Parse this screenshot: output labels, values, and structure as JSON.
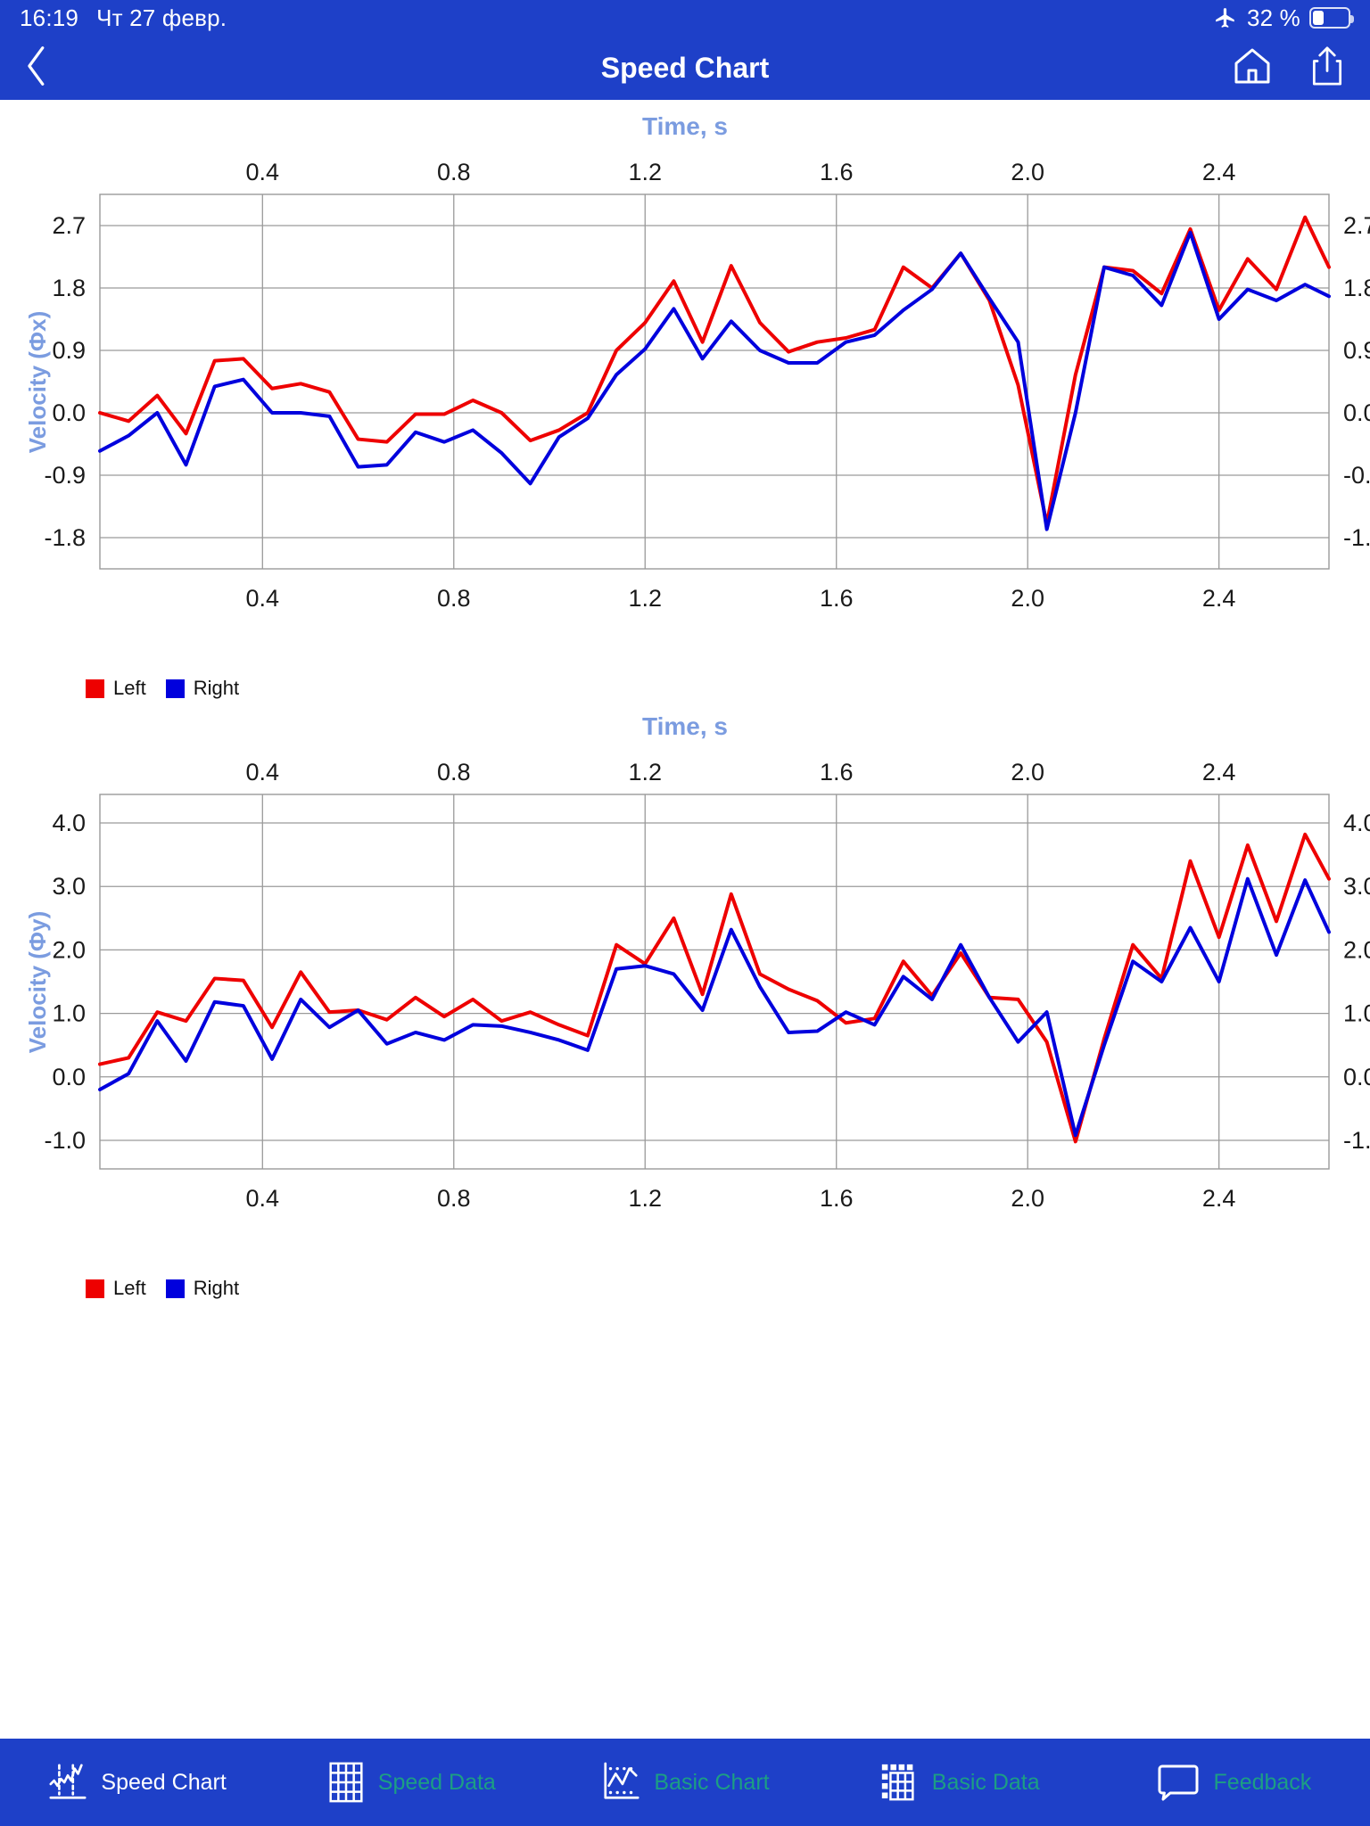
{
  "status_bar": {
    "time": "16:19",
    "date": "Чт 27 февр.",
    "airplane_icon": "airplane-mode-icon",
    "battery_percent": "32 %",
    "battery_level": 32
  },
  "nav_bar": {
    "back_icon": "chevron-left-icon",
    "title": "Speed Chart",
    "home_icon": "home-icon",
    "share_icon": "share-icon"
  },
  "charts": [
    {
      "id": "speed-chart-x",
      "title": "Time, s",
      "ylabel": "Velocity (Фx)",
      "legend": [
        {
          "label": "Left",
          "color": "#ee0000"
        },
        {
          "label": "Right",
          "color": "#0000dd"
        }
      ]
    },
    {
      "id": "speed-chart-y",
      "title": "Time, s",
      "ylabel": "Velocity (Фy)",
      "legend": [
        {
          "label": "Left",
          "color": "#ee0000"
        },
        {
          "label": "Right",
          "color": "#0000dd"
        }
      ]
    }
  ],
  "tab_bar": {
    "items": [
      {
        "label": "Speed Chart",
        "icon": "line-chart-icon",
        "active": true
      },
      {
        "label": "Speed Data",
        "icon": "grid-table-icon",
        "active": false
      },
      {
        "label": "Basic Chart",
        "icon": "scatter-chart-icon",
        "active": false
      },
      {
        "label": "Basic Data",
        "icon": "grid-table-partial-icon",
        "active": false
      },
      {
        "label": "Feedback",
        "icon": "speech-bubble-icon",
        "active": false
      }
    ],
    "active_color": "#ffffff",
    "inactive_color": "#1c9e84"
  },
  "chart_data": [
    {
      "type": "line",
      "id": "speed-chart-x",
      "title": "Time, s",
      "xlabel": "Time, s",
      "ylabel": "Velocity (Фx)",
      "xticks": [
        0.4,
        0.8,
        1.2,
        1.6,
        2.0,
        2.4
      ],
      "yticks": [
        -1.8,
        -0.9,
        0.0,
        0.9,
        1.8,
        2.7
      ],
      "xlim": [
        0.06,
        2.63
      ],
      "ylim": [
        -2.25,
        3.15
      ],
      "grid": true,
      "xaxis_position": "both",
      "yaxis_position": "both",
      "legend_position": "bottom-left",
      "x": [
        0.06,
        0.12,
        0.18,
        0.24,
        0.3,
        0.36,
        0.42,
        0.48,
        0.54,
        0.6,
        0.66,
        0.72,
        0.78,
        0.84,
        0.9,
        0.96,
        1.02,
        1.08,
        1.14,
        1.2,
        1.26,
        1.32,
        1.38,
        1.44,
        1.5,
        1.56,
        1.62,
        1.68,
        1.74,
        1.8,
        1.86,
        1.92,
        1.98,
        2.04,
        2.1,
        2.16,
        2.22,
        2.28,
        2.34,
        2.4,
        2.46,
        2.52,
        2.58,
        2.63
      ],
      "series": [
        {
          "name": "Left",
          "color": "#ee0000",
          "values": [
            0.0,
            -0.12,
            0.25,
            -0.3,
            0.75,
            0.78,
            0.35,
            0.42,
            0.3,
            -0.38,
            -0.42,
            -0.02,
            -0.02,
            0.18,
            0.0,
            -0.4,
            -0.25,
            0.0,
            0.9,
            1.3,
            1.9,
            1.02,
            2.12,
            1.3,
            0.88,
            1.02,
            1.08,
            1.2,
            2.1,
            1.8,
            2.3,
            1.62,
            0.4,
            -1.6,
            0.55,
            2.1,
            2.05,
            1.72,
            2.65,
            1.48,
            2.22,
            1.78,
            2.82,
            2.1
          ]
        },
        {
          "name": "Right",
          "color": "#0000dd",
          "values": [
            -0.55,
            -0.33,
            0.0,
            -0.75,
            0.38,
            0.48,
            0.0,
            0.0,
            -0.05,
            -0.78,
            -0.75,
            -0.28,
            -0.42,
            -0.25,
            -0.58,
            -1.02,
            -0.35,
            -0.08,
            0.55,
            0.92,
            1.5,
            0.78,
            1.32,
            0.9,
            0.72,
            0.72,
            1.02,
            1.12,
            1.48,
            1.78,
            2.3,
            1.65,
            1.02,
            -1.68,
            0.0,
            2.1,
            1.98,
            1.55,
            2.6,
            1.35,
            1.78,
            1.62,
            1.85,
            1.68
          ]
        }
      ]
    },
    {
      "type": "line",
      "id": "speed-chart-y",
      "title": "Time, s",
      "xlabel": "Time, s",
      "ylabel": "Velocity (Фy)",
      "xticks": [
        0.4,
        0.8,
        1.2,
        1.6,
        2.0,
        2.4
      ],
      "yticks": [
        -1.0,
        0.0,
        1.0,
        2.0,
        3.0,
        4.0
      ],
      "xlim": [
        0.06,
        2.63
      ],
      "ylim": [
        -1.45,
        4.45
      ],
      "grid": true,
      "xaxis_position": "both",
      "yaxis_position": "both",
      "legend_position": "bottom-left",
      "x": [
        0.06,
        0.12,
        0.18,
        0.24,
        0.3,
        0.36,
        0.42,
        0.48,
        0.54,
        0.6,
        0.66,
        0.72,
        0.78,
        0.84,
        0.9,
        0.96,
        1.02,
        1.08,
        1.14,
        1.2,
        1.26,
        1.32,
        1.38,
        1.44,
        1.5,
        1.56,
        1.62,
        1.68,
        1.74,
        1.8,
        1.86,
        1.92,
        1.98,
        2.04,
        2.1,
        2.16,
        2.22,
        2.28,
        2.34,
        2.4,
        2.46,
        2.52,
        2.58,
        2.63
      ],
      "series": [
        {
          "name": "Left",
          "color": "#ee0000",
          "values": [
            0.2,
            0.3,
            1.02,
            0.88,
            1.55,
            1.52,
            0.78,
            1.65,
            1.02,
            1.05,
            0.9,
            1.25,
            0.95,
            1.22,
            0.88,
            1.02,
            0.82,
            0.65,
            2.08,
            1.78,
            2.5,
            1.3,
            2.88,
            1.62,
            1.38,
            1.2,
            0.85,
            0.92,
            1.82,
            1.28,
            1.95,
            1.25,
            1.22,
            0.55,
            -1.02,
            0.6,
            2.08,
            1.55,
            3.4,
            2.2,
            3.65,
            2.45,
            3.82,
            3.12
          ]
        },
        {
          "name": "Right",
          "color": "#0000dd",
          "values": [
            -0.2,
            0.05,
            0.88,
            0.25,
            1.18,
            1.12,
            0.28,
            1.22,
            0.78,
            1.05,
            0.52,
            0.7,
            0.58,
            0.82,
            0.8,
            0.7,
            0.58,
            0.42,
            1.7,
            1.75,
            1.62,
            1.05,
            2.32,
            1.42,
            0.7,
            0.72,
            1.02,
            0.82,
            1.58,
            1.22,
            2.08,
            1.25,
            0.55,
            1.02,
            -0.92,
            0.5,
            1.82,
            1.5,
            2.35,
            1.5,
            3.12,
            1.92,
            3.1,
            2.28
          ]
        }
      ]
    }
  ]
}
